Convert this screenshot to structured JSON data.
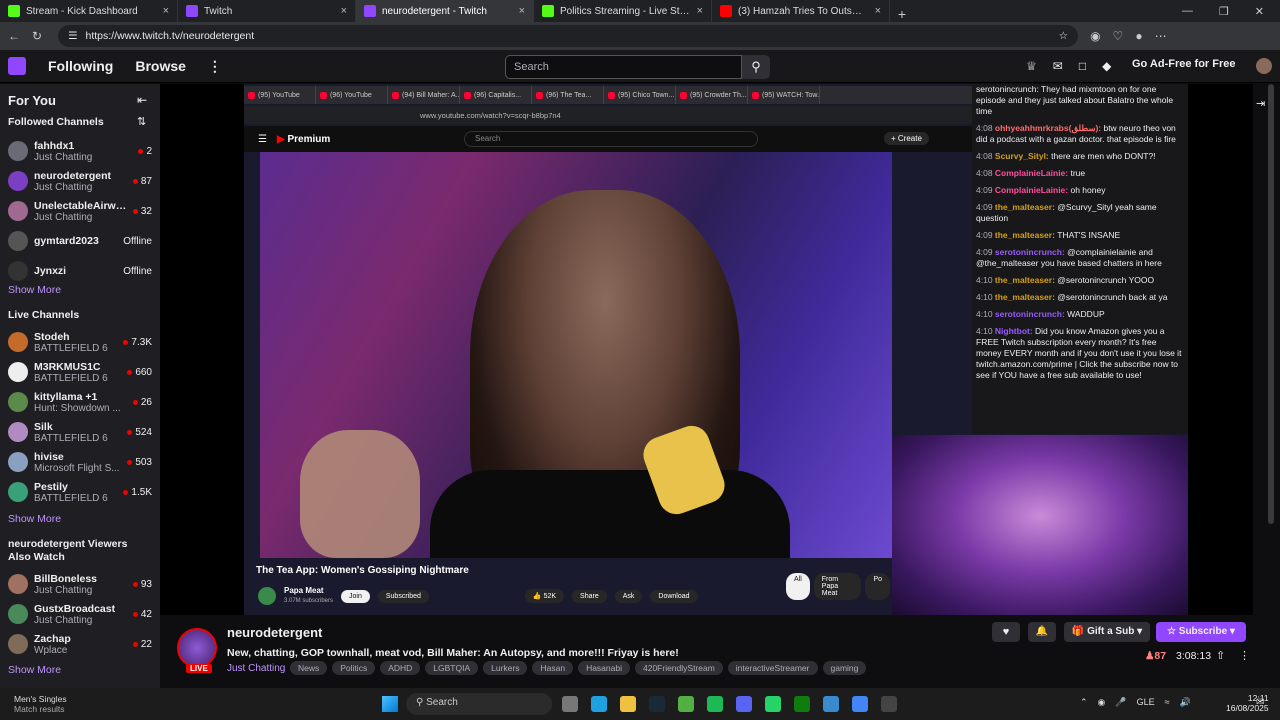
{
  "browser": {
    "tabs": [
      {
        "title": "Stream - Kick Dashboard",
        "color": "#53fc18"
      },
      {
        "title": "Twitch",
        "color": "#9147ff"
      },
      {
        "title": "neurodetergent - Twitch",
        "color": "#9147ff",
        "active": true
      },
      {
        "title": "Politics Streaming - Live Streams",
        "color": "#53fc18"
      },
      {
        "title": "(3) Hamzah Tries To Outsmart Isr...",
        "color": "#ff0000"
      }
    ],
    "url": "https://www.twitch.tv/neurodetergent"
  },
  "topnav": {
    "following": "Following",
    "browse": "Browse",
    "search_placeholder": "Search",
    "ad_free": "Go Ad-Free for Free"
  },
  "sidebar": {
    "for_you": "For You",
    "followed_header": "Followed Channels",
    "followed": [
      {
        "name": "fahhdx1",
        "game": "Just Chatting",
        "viewers": "2",
        "color": "#6b6b78"
      },
      {
        "name": "neurodetergent",
        "game": "Just Chatting",
        "viewers": "87",
        "color": "#7a3fc2"
      },
      {
        "name": "UnelectableAirwa...",
        "game": "Just Chatting",
        "viewers": "32",
        "color": "#a06a90"
      },
      {
        "name": "gymtard2023",
        "game": "",
        "viewers": "Offline",
        "color": "#555"
      },
      {
        "name": "Jynxzi",
        "game": "",
        "viewers": "Offline",
        "color": "#333"
      }
    ],
    "show_more_1": "Show More",
    "live_header": "Live Channels",
    "live": [
      {
        "name": "Stodeh",
        "game": "BATTLEFIELD 6",
        "viewers": "7.3K",
        "color": "#c46a2a"
      },
      {
        "name": "M3RKMUS1C",
        "game": "BATTLEFIELD 6",
        "viewers": "660",
        "color": "#eeeeee"
      },
      {
        "name": "kittyllama +1",
        "game": "Hunt: Showdown ...",
        "viewers": "26",
        "color": "#5c8a4a"
      },
      {
        "name": "Silk",
        "game": "BATTLEFIELD 6",
        "viewers": "524",
        "color": "#b08ac0"
      },
      {
        "name": "hivise",
        "game": "Microsoft Flight S...",
        "viewers": "503",
        "color": "#8aa0c0"
      },
      {
        "name": "Pestily",
        "game": "BATTLEFIELD 6",
        "viewers": "1.5K",
        "color": "#3aa07a"
      }
    ],
    "show_more_2": "Show More",
    "also_header": "neurodetergent Viewers Also Watch",
    "also": [
      {
        "name": "BillBoneless",
        "game": "Just Chatting",
        "viewers": "93",
        "color": "#a07060"
      },
      {
        "name": "GustxBroadcast",
        "game": "Just Chatting",
        "viewers": "42",
        "color": "#4a8a5a"
      },
      {
        "name": "Zachap",
        "game": "Wplace",
        "viewers": "22",
        "color": "#806a5a"
      }
    ],
    "show_more_3": "Show More"
  },
  "stream": {
    "inner_tabs": [
      "(95) YouTube",
      "(96) YouTube",
      "(94) Bill Maher: A...",
      "(96) Capitalis...",
      "(96) The Tea...",
      "(95) Chico Town...",
      "(95) Crowder Th...",
      "(95) WATCH: Tow..."
    ],
    "inner_url": "www.youtube.com/watch?v=scqr-b8bp7n4",
    "yt_logo": "Premium",
    "yt_search": "Search",
    "yt_create": "+ Create",
    "video_title": "The Tea App: Women's Gossiping Nightmare",
    "channel": "Papa Meat",
    "subs": "3.07M subscribers",
    "join": "Join",
    "subscribed": "Subscribed",
    "likes": "52K",
    "share": "Share",
    "ask": "Ask",
    "download": "Download",
    "chips": [
      "All",
      "From Papa Meat",
      "Po"
    ]
  },
  "chat": [
    {
      "ts": "",
      "user": "",
      "ucls": "",
      "msg": "serotonincrunch: They had mixmtoon on for one episode and they just talked about Balatro the whole time"
    },
    {
      "ts": "4:08",
      "user": "ohhyeahhmrkrabs(سطلق):",
      "ucls": "u3",
      "msg": "btw neuro theo von did a podcast with a gazan doctor. that episode is fire"
    },
    {
      "ts": "4:08",
      "user": "Scurvy_Sityl:",
      "ucls": "u1",
      "msg": "there are men who DONT?!"
    },
    {
      "ts": "4:08",
      "user": "ComplainieLainie:",
      "ucls": "u4",
      "msg": "true"
    },
    {
      "ts": "4:09",
      "user": "ComplainieLainie:",
      "ucls": "u4",
      "msg": "oh honey"
    },
    {
      "ts": "4:09",
      "user": "the_malteaser:",
      "ucls": "u1",
      "msg": "@Scurvy_Sityl yeah same question"
    },
    {
      "ts": "4:09",
      "user": "the_malteaser:",
      "ucls": "u1",
      "msg": "THAT'S INSANE"
    },
    {
      "ts": "4:09",
      "user": "serotonincrunch:",
      "ucls": "u2",
      "msg": "@complainielainie and @the_malteaser you have based chatters in here"
    },
    {
      "ts": "4:10",
      "user": "the_malteaser:",
      "ucls": "u1",
      "msg": "@serotonincrunch YOOO"
    },
    {
      "ts": "4:10",
      "user": "the_malteaser:",
      "ucls": "u1",
      "msg": "@serotonincrunch back at ya"
    },
    {
      "ts": "4:10",
      "user": "serotonincrunch:",
      "ucls": "u2",
      "msg": "WADDUP"
    },
    {
      "ts": "4:10",
      "user": "Nightbot:",
      "ucls": "u2",
      "msg": "Did you know Amazon gives you a FREE Twitch subscription every month? It's free money EVERY month and if you don't use it you lose it twitch.amazon.com/prime | Click the subscribe now to see if YOU have a free sub available to use!"
    }
  ],
  "info": {
    "live_label": "LIVE",
    "name": "neurodetergent",
    "title": "New, chatting, GOP townhall, meat vod, Bill Maher: An Autopsy, and more!!! Friyay is here!",
    "category": "Just Chatting",
    "tags": [
      "News",
      "Politics",
      "ADHD",
      "LGBTQIA",
      "Lurkers",
      "Hasan",
      "Hasanabi",
      "420FriendlyStream",
      "interactiveStreamer",
      "gaming"
    ],
    "gift": "Gift a Sub",
    "subscribe": "Subscribe",
    "viewers": "87",
    "uptime": "3:08:13"
  },
  "taskbar": {
    "weather_title": "Men's Singles",
    "weather_sub": "Match results",
    "search": "Search",
    "lang": "GLE",
    "time": "12:11",
    "date": "16/08/2025"
  }
}
